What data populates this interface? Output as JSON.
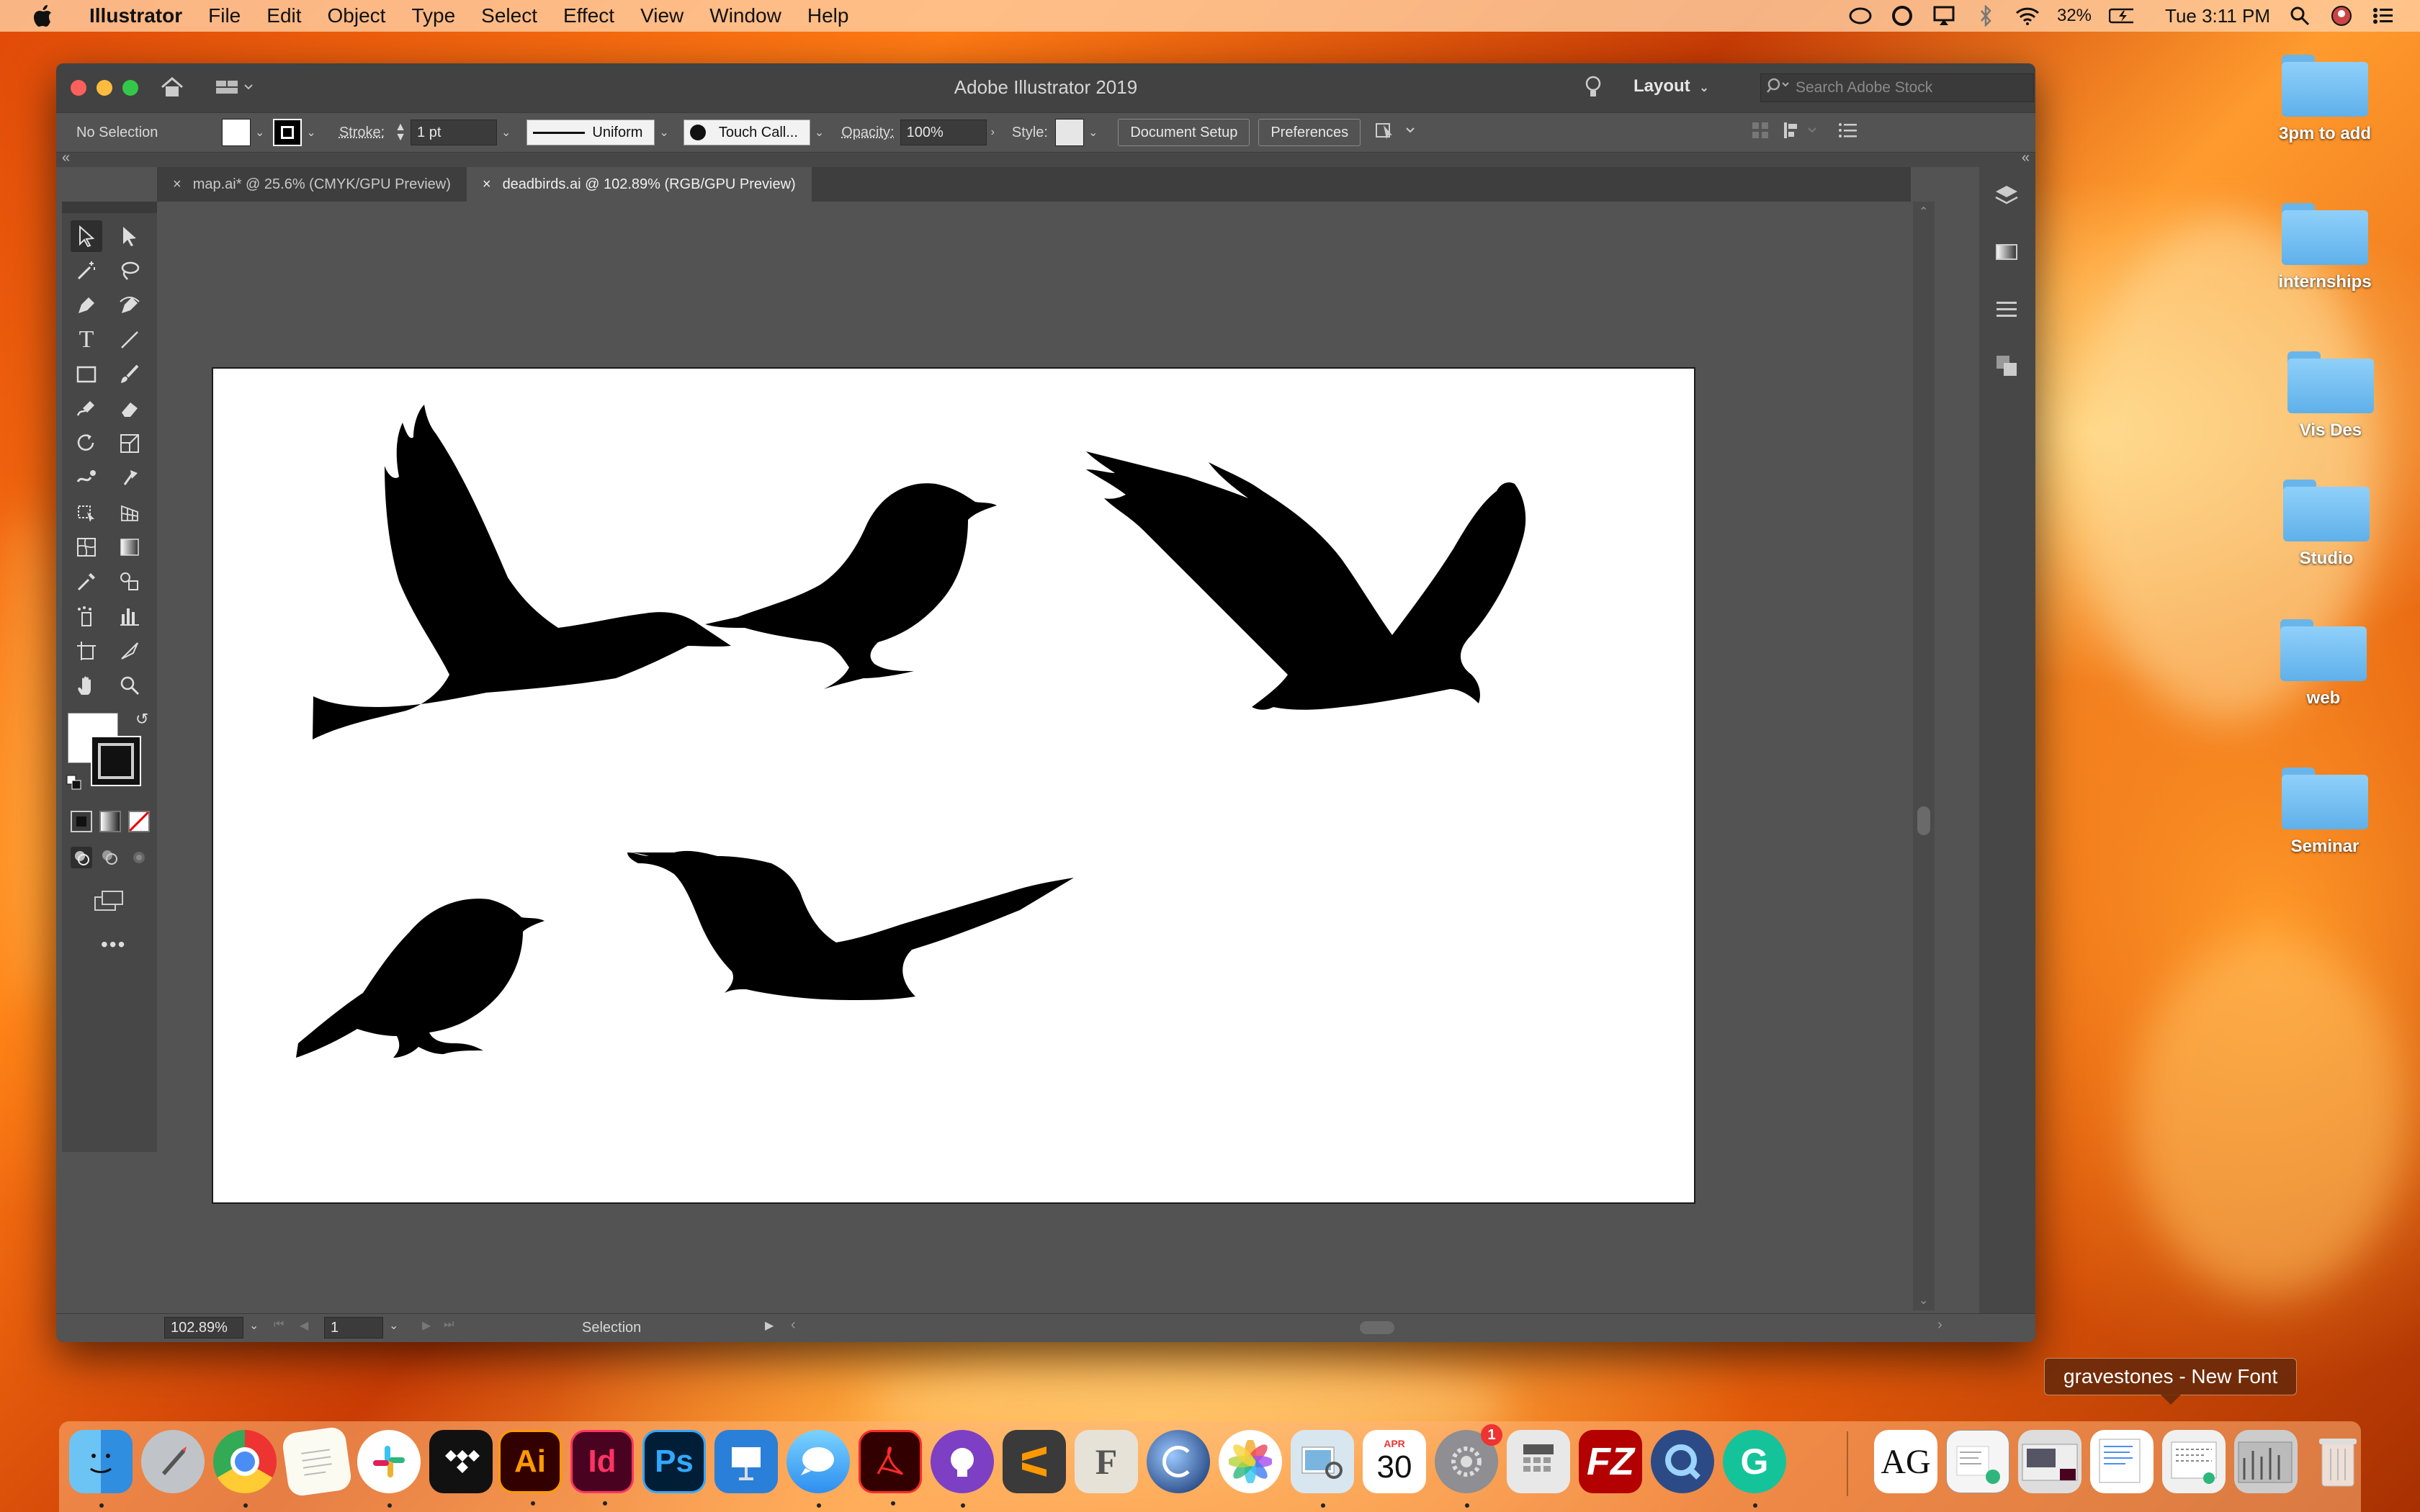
{
  "menubar": {
    "app_name": "Illustrator",
    "items": [
      "File",
      "Edit",
      "Object",
      "Type",
      "Select",
      "Effect",
      "View",
      "Window",
      "Help"
    ],
    "battery": "32%",
    "clock": "Tue 3:11 PM"
  },
  "window": {
    "title": "Adobe Illustrator 2019",
    "workspace": "Layout",
    "search_placeholder": "Search Adobe Stock"
  },
  "control_bar": {
    "selection": "No Selection",
    "stroke_label": "Stroke:",
    "stroke_value": "1 pt",
    "profile": "Uniform",
    "brush": "Touch Call...",
    "opacity_label": "Opacity:",
    "opacity_value": "100%",
    "style_label": "Style:",
    "document_setup": "Document Setup",
    "preferences": "Preferences"
  },
  "tabs": [
    {
      "label": "map.ai* @ 25.6% (CMYK/GPU Preview)",
      "active": false
    },
    {
      "label": "deadbirds.ai @ 102.89% (RGB/GPU Preview)",
      "active": true
    }
  ],
  "statusbar": {
    "zoom": "102.89%",
    "artboard": "1",
    "status": "Selection"
  },
  "desktop_icons": [
    {
      "label": "3pm to add"
    },
    {
      "label": "internships"
    },
    {
      "label": "Vis Des"
    },
    {
      "label": "Studio"
    },
    {
      "label": "web"
    },
    {
      "label": "Seminar"
    }
  ],
  "tooltip": "gravestones - New Font",
  "dock_labels": {
    "ai": "Ai",
    "id": "Id",
    "ps": "Ps",
    "cal_month": "APR",
    "cal_day": "30",
    "badge": "1",
    "font_preview": "AG"
  },
  "colors": {
    "ui_bg": "#535353",
    "ui_dark": "#424242",
    "accent_folder": "#6cb8ef"
  }
}
